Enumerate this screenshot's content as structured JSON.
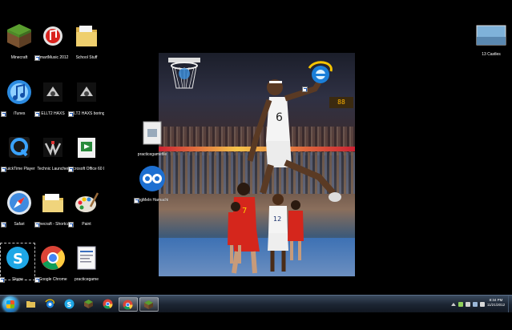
{
  "desktop_icons": [
    {
      "name": "Minecraft",
      "shortcut": false
    },
    {
      "name": "SmartMusic 2012",
      "shortcut": true
    },
    {
      "name": "School Stuff",
      "shortcut": false
    },
    {
      "name": "iTunes",
      "shortcut": true
    },
    {
      "name": "ELLT2 HAXS",
      "shortcut": true
    },
    {
      "name": "ELLT2 HAXS boring stuff",
      "shortcut": true
    },
    {
      "name": "QuickTime Player",
      "shortcut": true
    },
    {
      "name": "Technic Launcher",
      "shortcut": false
    },
    {
      "name": "Microsoft Office 60 Day Trial",
      "shortcut": true
    },
    {
      "name": "Safari",
      "shortcut": true
    },
    {
      "name": "minecraft - Shortcut",
      "shortcut": true
    },
    {
      "name": "Paint",
      "shortcut": true
    },
    {
      "name": "Skype",
      "shortcut": true
    },
    {
      "name": "Google Chrome",
      "shortcut": true
    },
    {
      "name": "practicegame",
      "shortcut": false
    },
    {
      "name": "practicegamefile",
      "shortcut": false
    },
    {
      "name": "LogMeIn Hamachi",
      "shortcut": true
    },
    {
      "name": "13 Castles",
      "shortcut": false
    }
  ],
  "wallpaper": {
    "scoreboard": "88"
  },
  "taskbar": {
    "buttons": [
      "Windows Explorer",
      "Internet Explorer",
      "Skype",
      "Minecraft",
      "Google Chrome",
      "Minecraft"
    ],
    "clock_time": "8:34 PM",
    "clock_date": "11/21/2012"
  },
  "colors": {
    "taskbar": "#1c2533",
    "desktop": "#000000",
    "accent": "#2a86c8"
  }
}
